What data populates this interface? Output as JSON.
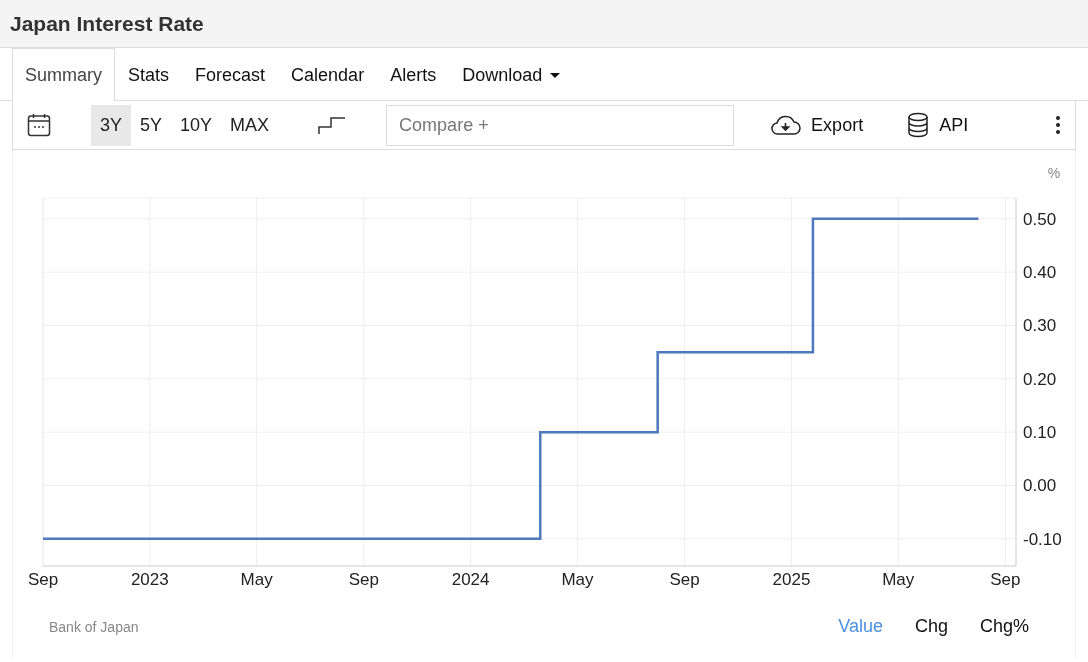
{
  "title": "Japan Interest Rate",
  "tabs": [
    {
      "label": "Summary",
      "selected": true,
      "kind": "link"
    },
    {
      "label": "Stats",
      "selected": false,
      "kind": "link"
    },
    {
      "label": "Forecast",
      "selected": false,
      "kind": "link"
    },
    {
      "label": "Calendar",
      "selected": false,
      "kind": "link"
    },
    {
      "label": "Alerts",
      "selected": false,
      "kind": "link"
    },
    {
      "label": "Download",
      "selected": false,
      "kind": "dropdown"
    }
  ],
  "ranges": [
    {
      "label": "3Y",
      "selected": true
    },
    {
      "label": "5Y",
      "selected": false
    },
    {
      "label": "10Y",
      "selected": false
    },
    {
      "label": "MAX",
      "selected": false
    }
  ],
  "compare": {
    "placeholder": "Compare +"
  },
  "actions": [
    {
      "label": "Export",
      "kind": "export"
    },
    {
      "label": "API",
      "kind": "api"
    }
  ],
  "chart": {
    "unit": "%",
    "chart_data": {
      "type": "line",
      "x": [
        2022.667,
        2024.217,
        2024.217,
        2024.583,
        2024.583,
        2025.067,
        2025.067,
        2025.583
      ],
      "series": [
        {
          "color": "#4f79bd",
          "values": [
            -0.1,
            -0.1,
            0.1,
            0.1,
            0.25,
            0.25,
            0.5,
            0.5
          ]
        }
      ],
      "grid": true,
      "xlim": [
        2022.667,
        2025.7
      ],
      "ylim": [
        -0.151,
        0.539
      ],
      "xticks": [
        {
          "value": 2022.667,
          "label": "Sep"
        },
        2023,
        {
          "value": 2023.333,
          "label": "May"
        },
        {
          "value": 2023.667,
          "label": "Sep"
        },
        2024,
        {
          "value": 2024.333,
          "label": "May"
        },
        {
          "value": 2024.667,
          "label": "Sep"
        },
        2025,
        {
          "value": 2025.333,
          "label": "May"
        },
        {
          "value": 2025.667,
          "label": "Sep"
        }
      ],
      "yticks": [
        {
          "value": -0.1,
          "label": "-0.10"
        },
        {
          "value": 0,
          "label": "0.00"
        },
        {
          "value": 0.1,
          "label": "0.10"
        },
        {
          "value": 0.2,
          "label": "0.20"
        },
        {
          "value": 0.3,
          "label": "0.30"
        },
        {
          "value": 0.4,
          "label": "0.40"
        },
        {
          "value": 0.5,
          "label": "0.50"
        }
      ]
    }
  },
  "source": "Bank of Japan",
  "views": [
    {
      "label": "Value",
      "selected": true
    },
    {
      "label": "Chg",
      "selected": false
    },
    {
      "label": "Chg%",
      "selected": false
    }
  ]
}
